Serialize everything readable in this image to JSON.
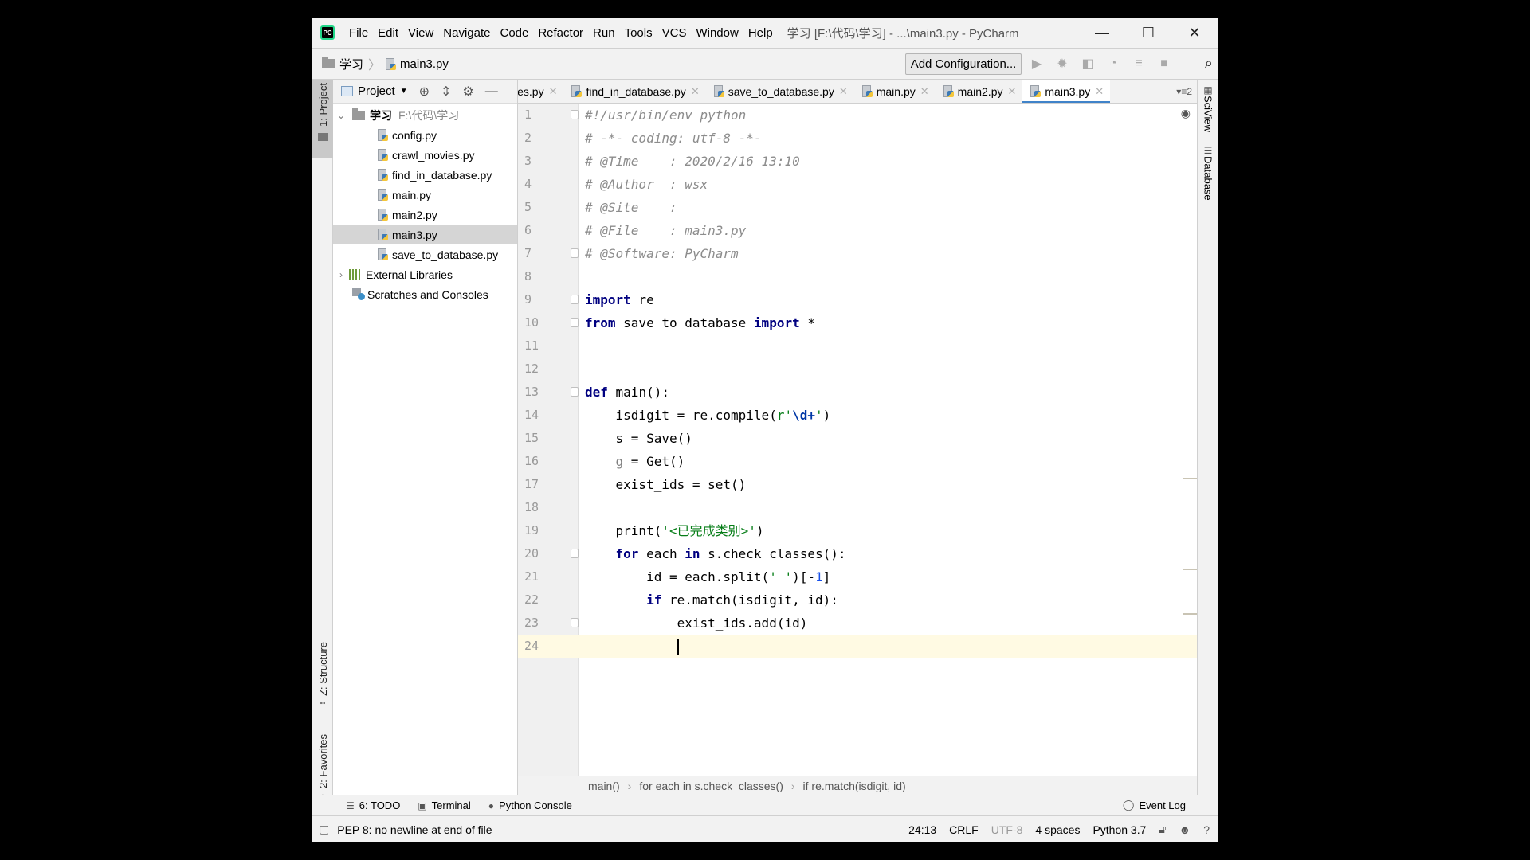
{
  "app": {
    "logo_text": "PC",
    "window_title": "学习 [F:\\代码\\学习] - ...\\main3.py - PyCharm",
    "controls": {
      "minimize": "—",
      "maximize": "☐",
      "close": "✕"
    }
  },
  "menu": [
    {
      "label": "File"
    },
    {
      "label": "Edit"
    },
    {
      "label": "View"
    },
    {
      "label": "Navigate"
    },
    {
      "label": "Code"
    },
    {
      "label": "Refactor"
    },
    {
      "label": "Run"
    },
    {
      "label": "Tools"
    },
    {
      "label": "VCS"
    },
    {
      "label": "Window"
    },
    {
      "label": "Help"
    }
  ],
  "navbar": {
    "breadcrumb": [
      "学习",
      "main3.py"
    ],
    "add_configuration": "Add Configuration...",
    "toolbar_icons": [
      "run-icon",
      "debug-icon",
      "coverage-icon",
      "profile-icon",
      "concurrency-icon",
      "stop-icon"
    ],
    "search_icon": "🔍"
  },
  "left_strip": {
    "project": "1: Project",
    "structure": "Z: Structure",
    "favorites": "2: Favorites"
  },
  "project_panel": {
    "title": "Project",
    "root": {
      "name": "学习",
      "path": "F:\\代码\\学习"
    },
    "files": [
      "config.py",
      "crawl_movies.py",
      "find_in_database.py",
      "main.py",
      "main2.py",
      "main3.py",
      "save_to_database.py"
    ],
    "selected": "main3.py",
    "external_libraries": "External Libraries",
    "scratches": "Scratches and Consoles"
  },
  "tabs": [
    {
      "label": "ies.py",
      "active": false
    },
    {
      "label": "find_in_database.py",
      "active": false
    },
    {
      "label": "save_to_database.py",
      "active": false
    },
    {
      "label": "main.py",
      "active": false
    },
    {
      "label": "main2.py",
      "active": false
    },
    {
      "label": "main3.py",
      "active": true
    }
  ],
  "tabs_more": "▾≡2",
  "right_strip": {
    "sciview": "SciView",
    "database": "Database"
  },
  "editor": {
    "current_line": 24,
    "lines": [
      "#!/usr/bin/env python",
      "# -*- coding: utf-8 -*-",
      "# @Time    : 2020/2/16 13:10",
      "# @Author  : wsx",
      "# @Site    : ",
      "# @File    : main3.py",
      "# @Software: PyCharm",
      "",
      "import re",
      "from save_to_database import *",
      "",
      "",
      "def main():",
      "    isdigit = re.compile(r'\\d+')",
      "    s = Save()",
      "    g = Get()",
      "    exist_ids = set()",
      "",
      "    print('<已完成类别>')",
      "    for each in s.check_classes():",
      "        id = each.split('_')[-1]",
      "        if re.match(isdigit, id):",
      "            exist_ids.add(id)",
      "            "
    ],
    "breadcrumb": [
      "main()",
      "for each in s.check_classes()",
      "if re.match(isdigit, id)"
    ]
  },
  "bottom_tools": {
    "todo": "6: TODO",
    "terminal": "Terminal",
    "python_console": "Python Console",
    "event_log": "Event Log"
  },
  "status": {
    "message": "PEP 8: no newline at end of file",
    "position": "24:13",
    "line_sep": "CRLF",
    "encoding": "UTF-8",
    "indent": "4 spaces",
    "interpreter": "Python 3.7"
  }
}
